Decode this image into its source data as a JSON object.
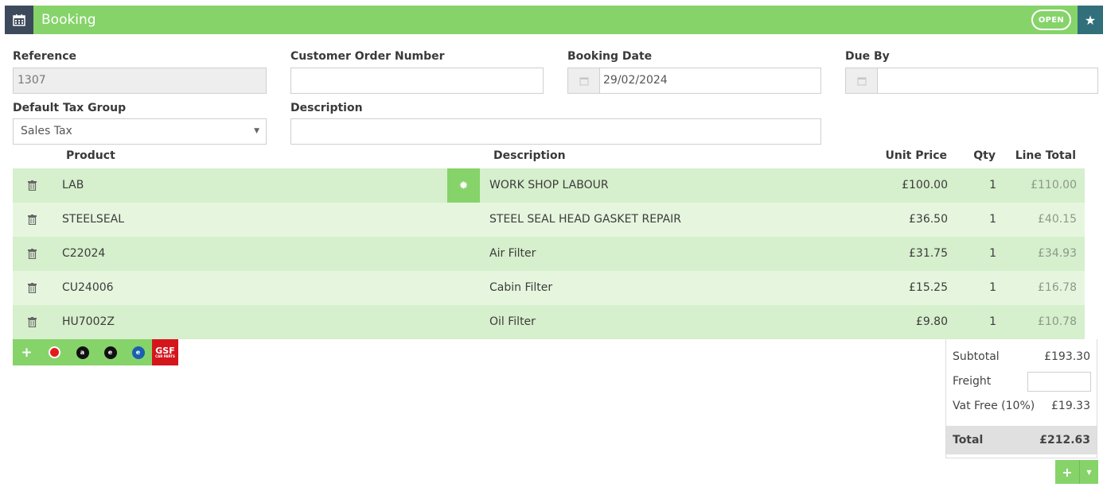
{
  "header": {
    "title": "Booking",
    "status_badge": "OPEN",
    "calendar_icon": "calendar-icon",
    "star_icon": "star-icon"
  },
  "form": {
    "reference": {
      "label": "Reference",
      "value": "1307"
    },
    "customer_order_number": {
      "label": "Customer  Order Number",
      "value": ""
    },
    "booking_date": {
      "label": "Booking Date",
      "value": "29/02/2024"
    },
    "due_by": {
      "label": "Due By",
      "value": ""
    },
    "default_tax_group": {
      "label": "Default Tax Group",
      "value": "Sales Tax"
    },
    "description": {
      "label": "Description",
      "value": ""
    }
  },
  "table": {
    "headers": {
      "product": "Product",
      "description": "Description",
      "unit_price": "Unit Price",
      "qty": "Qty",
      "line_total": "Line Total"
    },
    "rows": [
      {
        "product": "LAB",
        "description": "WORK SHOP LABOUR",
        "unit_price": "£100.00",
        "qty": "1",
        "line_total": "£110.00"
      },
      {
        "product": "STEELSEAL",
        "description": "STEEL SEAL HEAD GASKET REPAIR",
        "unit_price": "£36.50",
        "qty": "1",
        "line_total": "£40.15"
      },
      {
        "product": "C22024",
        "description": "Air Filter",
        "unit_price": "£31.75",
        "qty": "1",
        "line_total": "£34.93"
      },
      {
        "product": "CU24006",
        "description": "Cabin Filter",
        "unit_price": "£15.25",
        "qty": "1",
        "line_total": "£16.78"
      },
      {
        "product": "HU7002Z",
        "description": "Oil Filter",
        "unit_price": "£9.80",
        "qty": "1",
        "line_total": "£10.78"
      }
    ]
  },
  "toolbar": {
    "gsf_label": "GSF",
    "gsf_sub": "CAR PARTS",
    "logo_a": "a",
    "logo_b": "e",
    "logo_c": "e"
  },
  "totals": {
    "subtotal": {
      "label": "Subtotal",
      "value": "£193.30"
    },
    "freight": {
      "label": "Freight",
      "value": ""
    },
    "vat": {
      "label": "Vat Free (10%)",
      "value": "£19.33"
    },
    "total": {
      "label": "Total",
      "value": "£212.63"
    }
  },
  "colors": {
    "accent_green": "#86d36a",
    "header_dark": "#3d4a5c",
    "star_teal": "#31707a",
    "gsf_red": "#d4161c"
  }
}
